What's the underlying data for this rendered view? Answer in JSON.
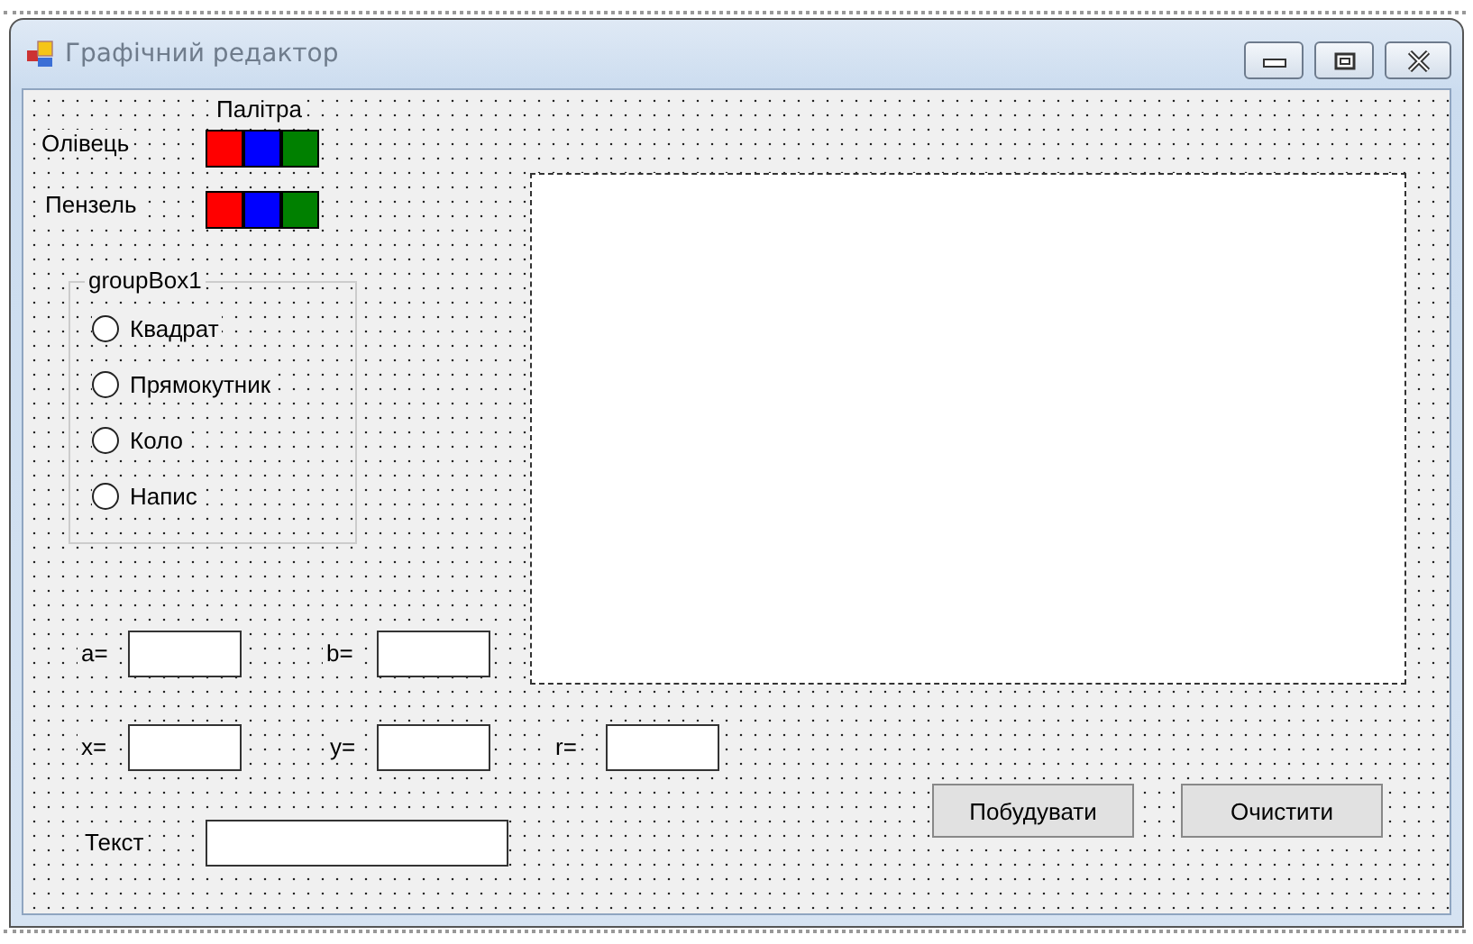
{
  "window": {
    "title": "Графічний редактор"
  },
  "palette": {
    "label": "Палітра"
  },
  "tools": [
    {
      "label": "Олівець",
      "swatches": [
        {
          "color": "#ff0000"
        },
        {
          "color": "#0000ff"
        },
        {
          "color": "#008000"
        }
      ]
    },
    {
      "label": "Пензель",
      "swatches": [
        {
          "color": "#ff0000"
        },
        {
          "color": "#0000ff"
        },
        {
          "color": "#008000"
        }
      ]
    }
  ],
  "group_box": {
    "title": "groupBox1",
    "options": [
      {
        "label": "Квадрат",
        "selected": false
      },
      {
        "label": "Прямокутник",
        "selected": false
      },
      {
        "label": "Коло",
        "selected": false
      },
      {
        "label": "Напис",
        "selected": false
      }
    ]
  },
  "fields": [
    {
      "label": "a="
    },
    {
      "label": "b="
    },
    {
      "label": "x="
    },
    {
      "label": "y="
    },
    {
      "label": "r="
    },
    {
      "label": "Текст"
    }
  ],
  "buttons": [
    "Побудувати",
    "Очистити"
  ]
}
